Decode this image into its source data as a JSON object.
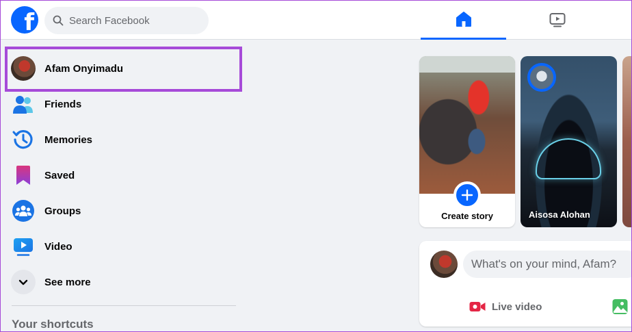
{
  "header": {
    "search_placeholder": "Search Facebook",
    "nav": [
      {
        "name": "home",
        "icon": "home-icon",
        "active": true
      },
      {
        "name": "video",
        "icon": "video-icon",
        "active": false
      }
    ]
  },
  "sidebar": {
    "items": [
      {
        "label": "Afam Onyimadu",
        "icon": "avatar"
      },
      {
        "label": "Friends",
        "icon": "friends-icon"
      },
      {
        "label": "Memories",
        "icon": "memories-clock-icon"
      },
      {
        "label": "Saved",
        "icon": "bookmark-icon"
      },
      {
        "label": "Groups",
        "icon": "groups-icon"
      },
      {
        "label": "Video",
        "icon": "video-play-icon"
      },
      {
        "label": "See more",
        "icon": "chevron-down-icon"
      }
    ],
    "shortcuts_title": "Your shortcuts"
  },
  "stories": {
    "create_label": "Create story",
    "items": [
      {
        "name": "Aisosa Alohan"
      }
    ]
  },
  "composer": {
    "placeholder": "What's on your mind, Afam?",
    "actions": [
      {
        "label": "Live video",
        "icon": "live-video-icon"
      },
      {
        "label": "",
        "icon": "photo-icon"
      }
    ]
  },
  "colors": {
    "brand": "#0866ff",
    "highlight": "#a64ad8",
    "background": "#f0f2f5",
    "live_red": "#e42645",
    "photo_green": "#45bd62"
  }
}
